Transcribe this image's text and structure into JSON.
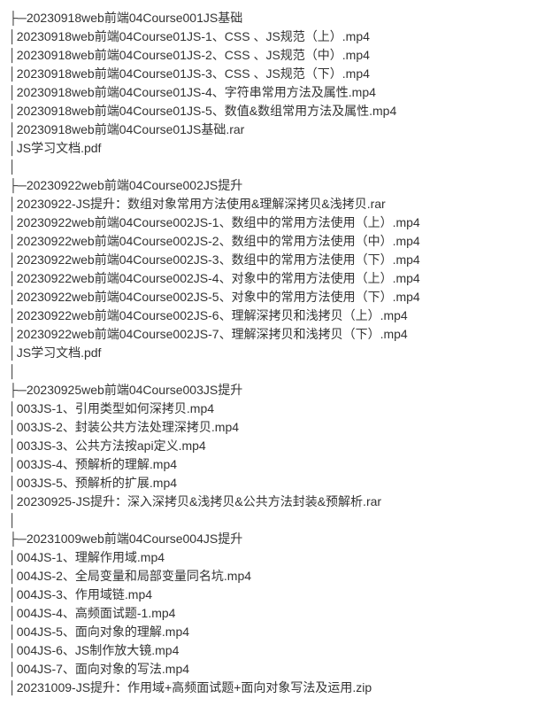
{
  "tree_branch": "├─",
  "tree_pipe": "│",
  "indent": "      ",
  "folders": [
    {
      "name": "20230918web前端04Course001JS基础",
      "files": [
        "20230918web前端04Course01JS-1、CSS 、JS规范（上）.mp4",
        "20230918web前端04Course01JS-2、CSS 、JS规范（中）.mp4",
        "20230918web前端04Course01JS-3、CSS 、JS规范（下）.mp4",
        "20230918web前端04Course01JS-4、字符串常用方法及属性.mp4",
        "20230918web前端04Course01JS-5、数值&数组常用方法及属性.mp4",
        "20230918web前端04Course01JS基础.rar",
        "JS学习文档.pdf"
      ]
    },
    {
      "name": "20230922web前端04Course002JS提升",
      "files": [
        "20230922-JS提升：数组对象常用方法使用&理解深拷贝&浅拷贝.rar",
        "20230922web前端04Course002JS-1、数组中的常用方法使用（上）.mp4",
        "20230922web前端04Course002JS-2、数组中的常用方法使用（中）.mp4",
        "20230922web前端04Course002JS-3、数组中的常用方法使用（下）.mp4",
        "20230922web前端04Course002JS-4、对象中的常用方法使用（上）.mp4",
        "20230922web前端04Course002JS-5、对象中的常用方法使用（下）.mp4",
        "20230922web前端04Course002JS-6、理解深拷贝和浅拷贝（上）.mp4",
        "20230922web前端04Course002JS-7、理解深拷贝和浅拷贝（下）.mp4",
        "JS学习文档.pdf"
      ]
    },
    {
      "name": "20230925web前端04Course003JS提升",
      "files": [
        "003JS-1、引用类型如何深拷贝.mp4",
        "003JS-2、封装公共方法处理深拷贝.mp4",
        "003JS-3、公共方法按api定义.mp4",
        "003JS-4、预解析的理解.mp4",
        "003JS-5、预解析的扩展.mp4",
        "20230925-JS提升：深入深拷贝&浅拷贝&公共方法封装&预解析.rar"
      ]
    },
    {
      "name": "20231009web前端04Course004JS提升",
      "files": [
        "004JS-1、理解作用域.mp4",
        "004JS-2、全局变量和局部变量同名坑.mp4",
        "004JS-3、作用域链.mp4",
        "004JS-4、高频面试题-1.mp4",
        "004JS-5、面向对象的理解.mp4",
        "004JS-6、JS制作放大镜.mp4",
        "004JS-7、面向对象的写法.mp4",
        "20231009-JS提升：作用域+高频面试题+面向对象写法及运用.zip"
      ]
    }
  ]
}
